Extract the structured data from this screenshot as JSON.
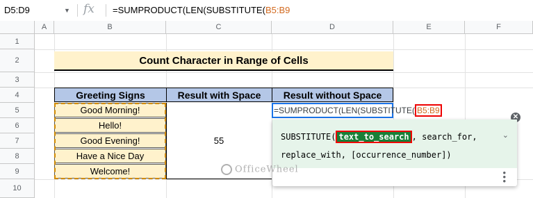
{
  "formula_bar": {
    "name_box": "D5:D9",
    "fx_label": "fx",
    "formula_prefix": "=SUMPRODUCT(LEN(SUBSTITUTE(",
    "formula_ref": "B5:B9"
  },
  "columns": [
    "A",
    "B",
    "C",
    "D",
    "E",
    "F"
  ],
  "rows": [
    "1",
    "2",
    "3",
    "4",
    "5",
    "6",
    "7",
    "8",
    "9",
    "10"
  ],
  "sheet": {
    "title": "Count Character in Range of Cells",
    "headers": [
      "Greeting Signs",
      "Result with Space",
      "Result without Space"
    ],
    "greetings": [
      "Good Morning!",
      "Hello!",
      "Good Evening!",
      "Have a Nice Day",
      "Welcome!"
    ],
    "result_with_space": "55"
  },
  "editor": {
    "text_prefix": "=SUMPRODUCT(LEN(SUBSTITUTE(",
    "text_ref": "B5:B9"
  },
  "popup": {
    "func_name": "SUBSTITUTE(",
    "active_arg": "text_to_search",
    "rest_line1": ", search_for,",
    "line2": "replace_with, [occurrence_number])"
  },
  "watermark": "OfficeWheel"
}
